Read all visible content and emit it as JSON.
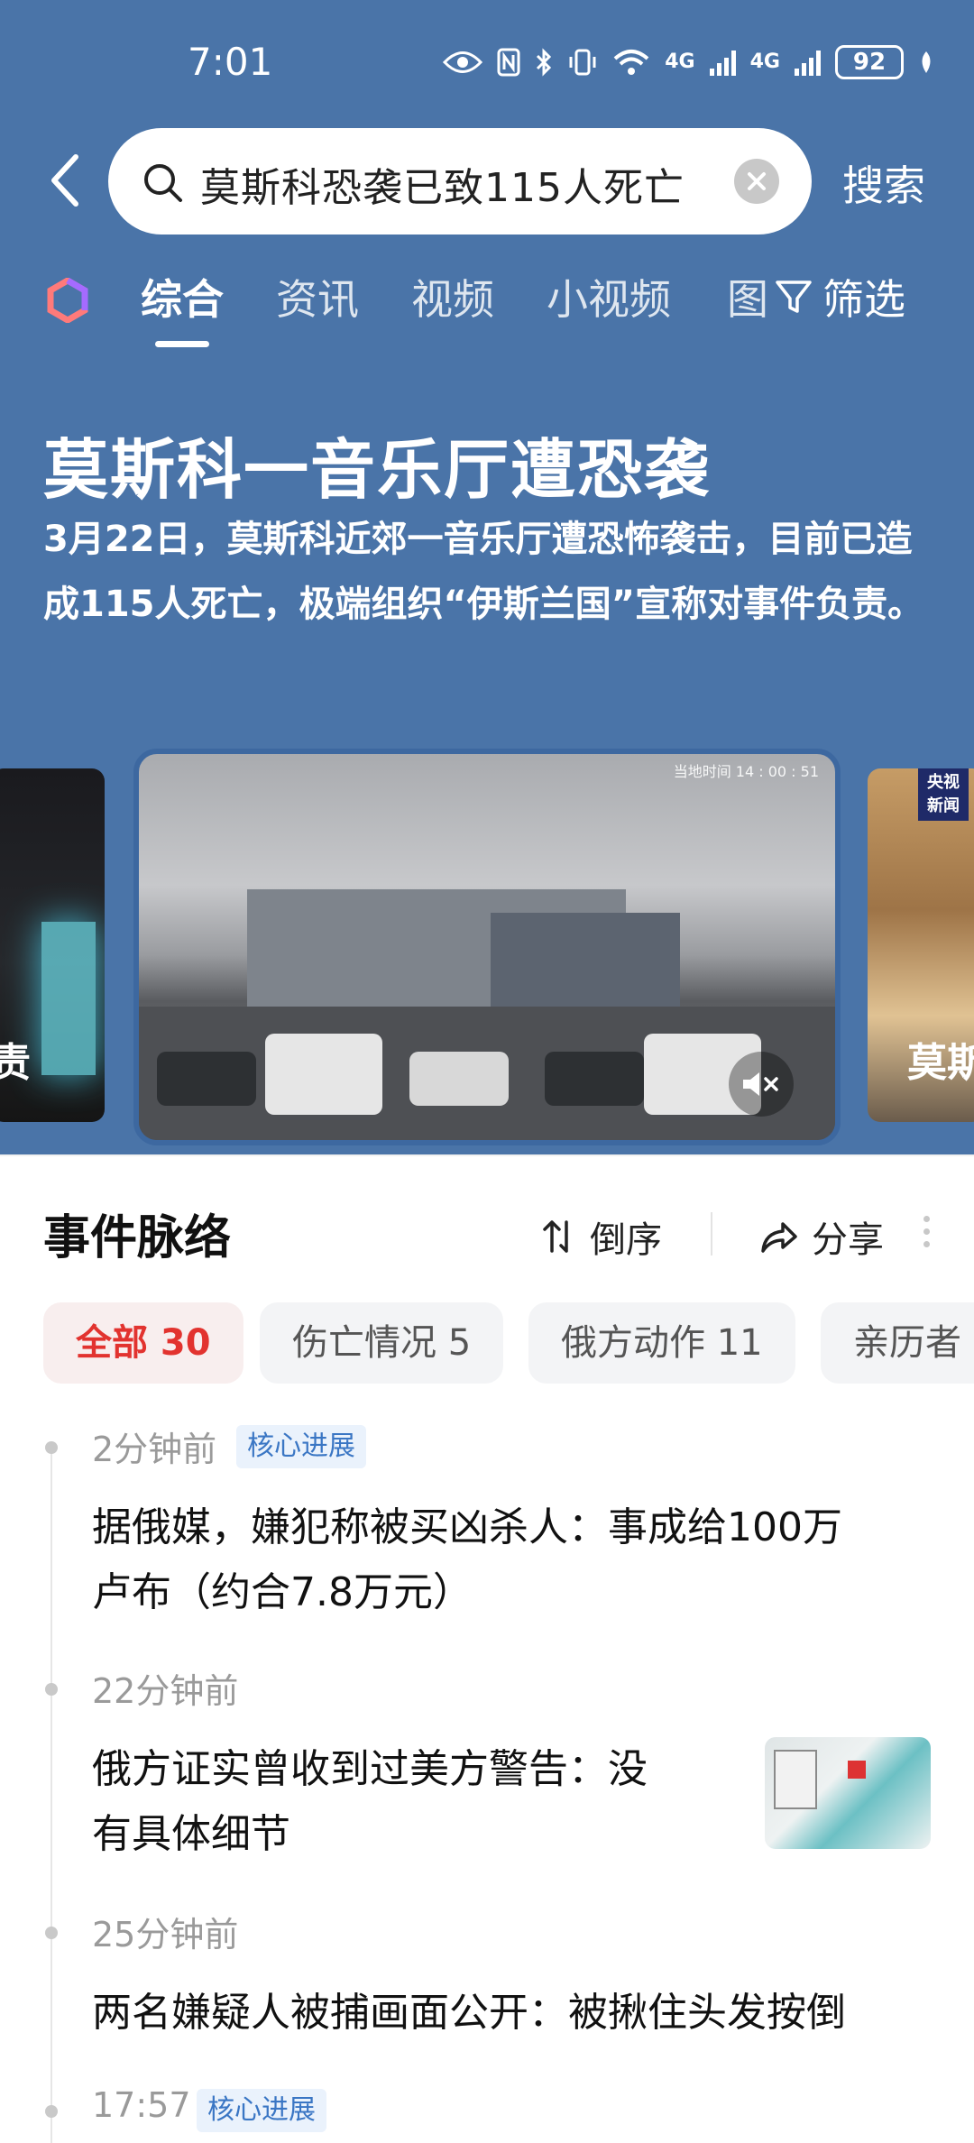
{
  "status_bar": {
    "time": "7:01",
    "network_1": "4G",
    "network_2": "4G",
    "battery": "92"
  },
  "search": {
    "query": "莫斯科恐袭已致115人死亡",
    "action_label": "搜索"
  },
  "tabs": {
    "items": [
      "综合",
      "资讯",
      "视频",
      "小视频",
      "图"
    ],
    "active_index": 0,
    "filter_label": "筛选"
  },
  "topic": {
    "title": "莫斯科一音乐厅遭恐袭",
    "summary": "3月22日，莫斯科近郊一音乐厅遭恐怖袭击，目前已造成115人死亡，极端组织“伊斯兰国”宣称对事件负责。"
  },
  "carousel": {
    "left_caption": "责",
    "main_watermark": "当地时间 14 : 00 : 51",
    "right_badge_line1": "央视",
    "right_badge_line2": "新闻",
    "right_caption": "莫斯"
  },
  "events": {
    "title": "事件脉络",
    "sort_label": "倒序",
    "share_label": "分享",
    "filters": [
      {
        "label": "全部 30",
        "active": true
      },
      {
        "label": "伤亡情况 5",
        "active": false
      },
      {
        "label": "俄方动作 11",
        "active": false
      },
      {
        "label": "亲历者",
        "active": false
      }
    ],
    "items": [
      {
        "time": "2分钟前",
        "tag": "核心进展",
        "text_line1": "据俄媒，嫌犯称被买凶杀人：事成给100万",
        "text_line2": "卢布（约合7.8万元）"
      },
      {
        "time": "22分钟前",
        "tag": "",
        "text_line1": "俄方证实曾收到过美方警告：没",
        "text_line2": "有具体细节"
      },
      {
        "time": "25分钟前",
        "tag": "",
        "text_line1": "两名嫌疑人被捕画面公开：被揪住头发按倒",
        "text_line2": ""
      },
      {
        "time": "17:57",
        "tag": "核心进展",
        "text_line1": "",
        "text_line2": ""
      }
    ]
  },
  "colors": {
    "hero_bg": "#4a74a8",
    "active_chip_text": "#e2332f",
    "tag_text": "#3a76c4"
  }
}
